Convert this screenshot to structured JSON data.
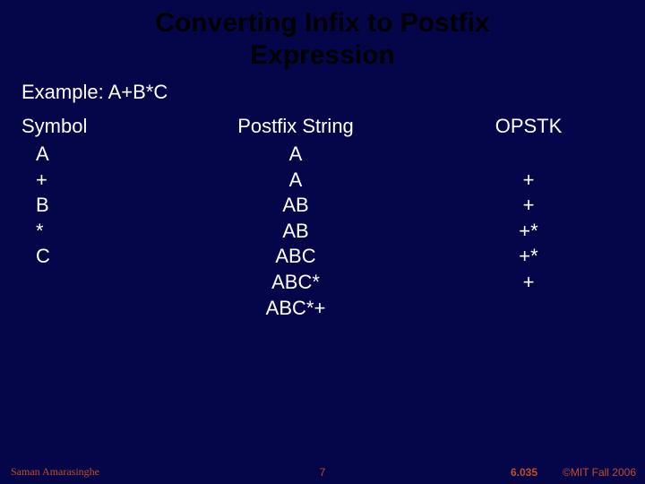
{
  "title_line1": "Converting Infix to Postfix",
  "title_line2": "Expression",
  "example": "Example: A+B*C",
  "headers": {
    "symbol": "Symbol",
    "postfix": "Postfix String",
    "opstk": "OPSTK"
  },
  "symbol": {
    "r0": "A",
    "r1": "+",
    "r2": "B",
    "r3": "*",
    "r4": "C"
  },
  "postfix": {
    "r0": "A",
    "r1": "A",
    "r2": "AB",
    "r3": "AB",
    "r4": "ABC",
    "r5": "ABC*",
    "r6": "ABC*+"
  },
  "opstk": {
    "r0": "",
    "r1": "+",
    "r2": "+",
    "r3": "+*",
    "r4": "+*",
    "r5": "+",
    "r6": ""
  },
  "footer": {
    "author": "Saman Amarasinghe",
    "page": "7",
    "course": "6.035",
    "copyright": "©MIT Fall 2006"
  }
}
